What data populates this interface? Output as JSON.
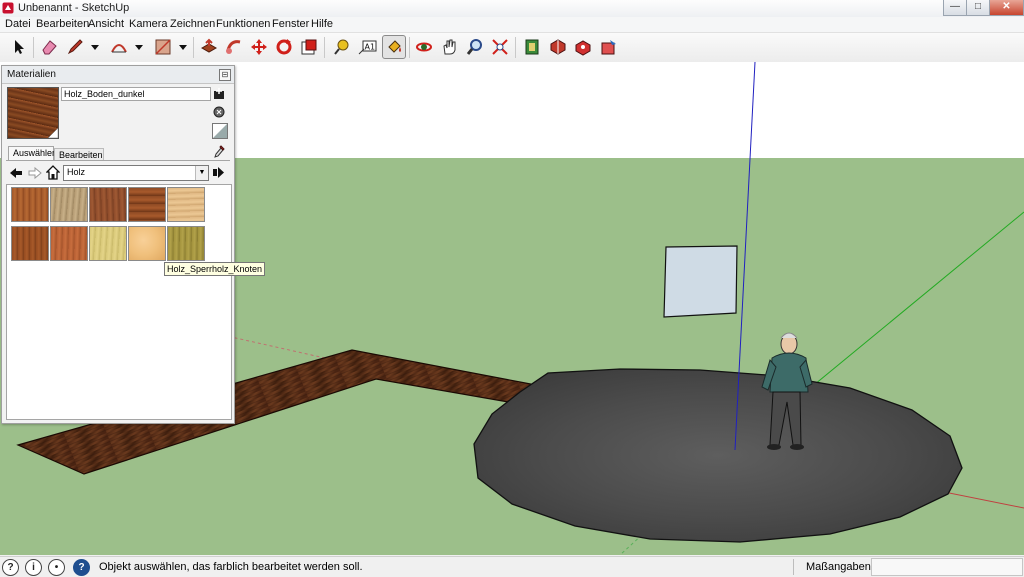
{
  "window": {
    "title": "Unbenannt - SketchUp",
    "minimize_glyph": "—",
    "maximize_glyph": "□",
    "close_glyph": "✕"
  },
  "menu": [
    "Datei",
    "Bearbeiten",
    "Ansicht",
    "Kamera",
    "Zeichnen",
    "Funktionen",
    "Fenster",
    "Hilfe"
  ],
  "toolbar": {
    "tools": [
      "select-icon",
      "eraser-icon",
      "pencil-icon",
      "arc-icon",
      "rectangle-icon",
      "push-pull-icon",
      "follow-me-icon",
      "move-icon",
      "rotate-icon",
      "scale-icon",
      "tape-measure-icon",
      "text-icon",
      "paint-bucket-icon",
      "orbit-icon",
      "pan-icon",
      "zoom-icon",
      "zoom-extents-icon",
      "3d-warehouse-icon",
      "get-models-icon",
      "share-model-icon",
      "upload-icon"
    ],
    "active_tool": "paint-bucket-icon",
    "text_tool_label": "A1"
  },
  "materials_panel": {
    "title": "Materialien",
    "material_name": "Holz_Boden_dunkel",
    "tabs": [
      "Auswählen",
      "Bearbeiten"
    ],
    "active_tab": "Auswählen",
    "library": "Holz",
    "swatch_colors": [
      "#a0572a",
      "#b49a72",
      "#8c4a2a",
      "#8e4a24",
      "#e0b884",
      "#954b20",
      "#b65e33",
      "#d8c878",
      "#f0c07c",
      "#a2923c"
    ],
    "tooltip": "Holz_Sperrholz_Knoten"
  },
  "status": {
    "message": "Objekt auswählen, das farblich bearbeitet werden soll.",
    "measure_label": "Maßangaben",
    "measure_value": ""
  },
  "colors": {
    "sky": "#ffffff",
    "ground": "#9cbf8a",
    "blue_axis": "#2020c0",
    "green_axis": "#22aa22",
    "red_axis": "#c04040"
  }
}
